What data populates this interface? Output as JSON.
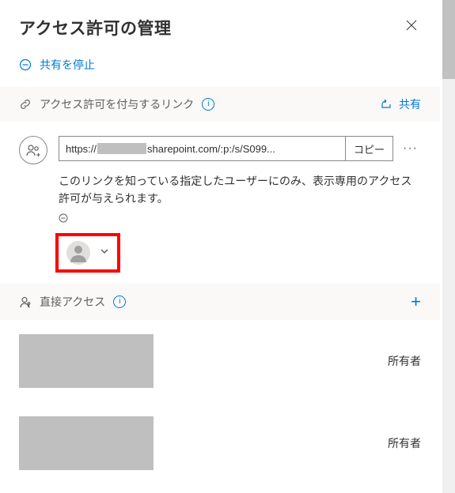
{
  "header": {
    "title": "アクセス許可の管理"
  },
  "actions": {
    "stop_sharing": "共有を停止",
    "share": "共有",
    "copy": "コピー"
  },
  "sections": {
    "links": {
      "title": "アクセス許可を付与するリンク"
    },
    "direct": {
      "title": "直接アクセス"
    }
  },
  "link": {
    "url_prefix": "https://",
    "url_suffix": "sharepoint.com/:p:/s/S099...",
    "description": "このリンクを知っている指定したユーザーにのみ、表示専用のアクセス許可が与えられます。"
  },
  "direct_access": {
    "members": [
      {
        "role": "所有者"
      },
      {
        "role": "所有者"
      }
    ]
  }
}
